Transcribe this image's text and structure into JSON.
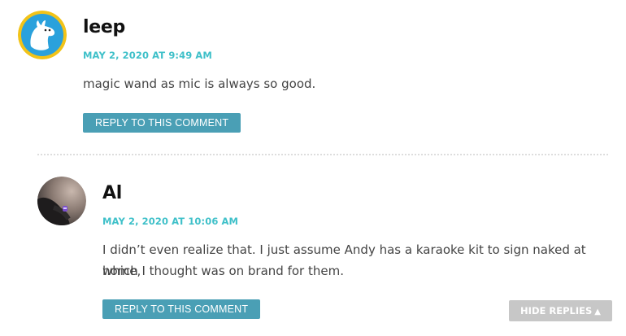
{
  "comments": [
    {
      "author": "leep",
      "date": "MAY 2, 2020 AT 9:49 AM",
      "lines": [
        "magic wand as mic is always so good."
      ],
      "reply_label": "REPLY TO THIS COMMENT",
      "avatar_icon": "moomin-avatar-icon",
      "colors": {
        "avatar_ring": "#f2c318",
        "avatar_bg": "#2aa1dc"
      }
    },
    {
      "author": "Al",
      "date": "MAY 2, 2020 AT 10:06 AM",
      "lines": [
        "I didn’t even realize that. I just assume Andy has a karaoke kit to sign naked at home,",
        "which I thought was on brand for them."
      ],
      "reply_label": "REPLY TO THIS COMMENT",
      "avatar_icon": "photo-avatar-icon"
    }
  ],
  "hide_replies_label": "HIDE REPLIES",
  "hide_replies_icon": "triangle-up-icon",
  "colors": {
    "date": "#3fc0c9",
    "reply_button": "#4a9fb5",
    "hide_replies_button": "#c7c7c7"
  }
}
